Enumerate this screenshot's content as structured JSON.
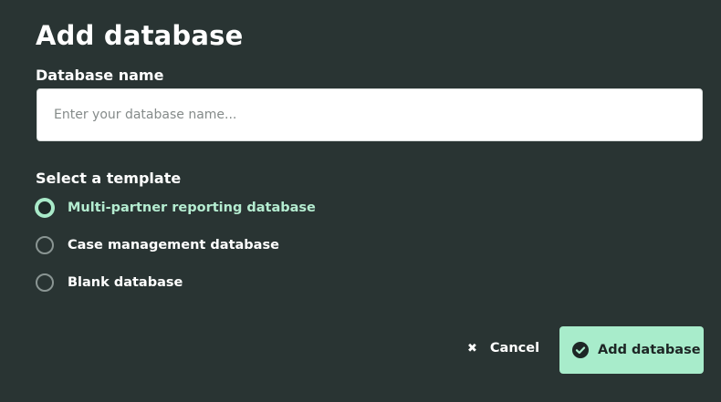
{
  "dialog": {
    "title": "Add database",
    "name_field": {
      "label": "Database name",
      "value": "",
      "placeholder": "Enter your database name..."
    },
    "template_section": {
      "label": "Select a template",
      "options": [
        {
          "label": "Multi-partner reporting database",
          "selected": true
        },
        {
          "label": "Case management database",
          "selected": false
        },
        {
          "label": "Blank database",
          "selected": false
        }
      ]
    },
    "actions": {
      "cancel_label": "Cancel",
      "cancel_icon": "close-icon",
      "submit_label": "Add database",
      "submit_icon": "check-circle-icon"
    }
  },
  "colors": {
    "background": "#293433",
    "accent": "#a8eccb",
    "selected_text": "#b4ecd0",
    "text": "#ffffff"
  }
}
